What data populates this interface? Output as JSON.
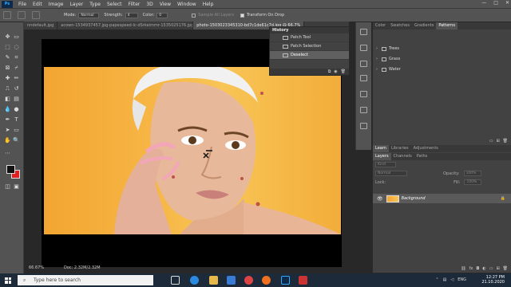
{
  "menu": {
    "logo": "Ps",
    "items": [
      "File",
      "Edit",
      "Image",
      "Layer",
      "Type",
      "Select",
      "Filter",
      "3D",
      "View",
      "Window",
      "Help"
    ],
    "window_controls": [
      "—",
      "□",
      "✕"
    ]
  },
  "options": {
    "mode_label": "Mode:",
    "mode_value": "Normal",
    "strength_label": "Strength:",
    "strength_value": "4",
    "color_label": "Color:",
    "color_value": "0",
    "sample_all_layers": "Sample All Layers",
    "transform_on_drop": "Transform On Drop"
  },
  "tabs": [
    {
      "label": "nndefault.jpg",
      "active": false
    },
    {
      "label": "acown-1534937457.jpg-papespeed-lc-dSrkeimmr-1535025176.jpg",
      "active": false
    },
    {
      "label": "photo-1503023345310-bd7c1de61c7d.jpg @ 66.7%",
      "active": true
    }
  ],
  "history": {
    "title": "History",
    "rows": [
      {
        "label": "Patch Tool",
        "active": false
      },
      {
        "label": "Patch Selection",
        "active": false
      },
      {
        "label": "Deselect",
        "active": true
      }
    ]
  },
  "patterns_panel": {
    "tabs": [
      {
        "label": "Color",
        "active": false
      },
      {
        "label": "Swatches",
        "active": false
      },
      {
        "label": "Gradients",
        "active": false
      },
      {
        "label": "Patterns",
        "active": true
      }
    ],
    "folders": [
      "Trees",
      "Grass",
      "Water"
    ]
  },
  "learn_tabs": [
    "Learn",
    "Libraries",
    "Adjustments"
  ],
  "layers_panel": {
    "tabs": [
      "Layers",
      "Channels",
      "Paths"
    ],
    "kind_label": "Kind",
    "blend_mode": "Normal",
    "opacity_label": "Opacity:",
    "opacity_value": "100%",
    "lock_label": "Lock:",
    "fill_label": "Fill:",
    "fill_value": "100%",
    "layer_name": "Background",
    "lock_icon": "🔒"
  },
  "status": {
    "zoom": "66.67%",
    "doc": "Doc: 2.32M/2.32M"
  },
  "taskbar": {
    "search_placeholder": "Type here to search",
    "time": "12:27 PM",
    "date": "21.10.2020",
    "tray_lang": "ENG"
  }
}
